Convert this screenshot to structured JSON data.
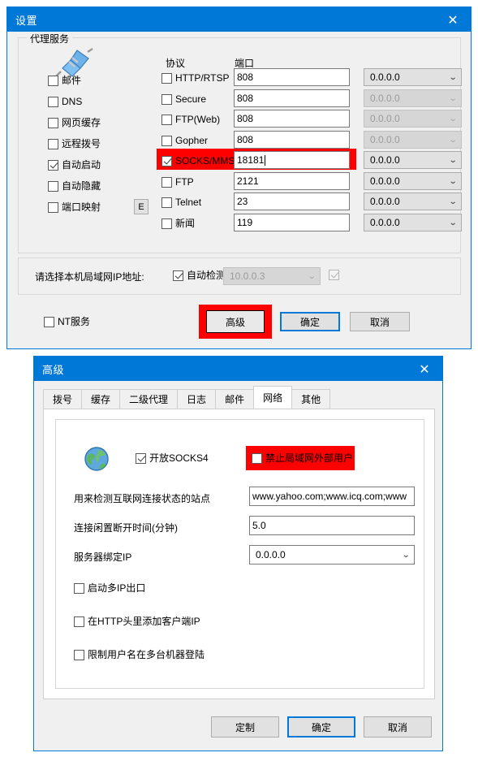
{
  "settings_window": {
    "title": "设置",
    "close_icon": "close-icon",
    "proxy_group": {
      "legend": "代理服务",
      "icon": "plug-connector-icon",
      "col_protocol": "协议",
      "col_port": "端口",
      "left_options": [
        {
          "label": "邮件",
          "checked": false
        },
        {
          "label": "DNS",
          "checked": false
        },
        {
          "label": "网页缓存",
          "checked": false
        },
        {
          "label": "远程拨号",
          "checked": false
        },
        {
          "label": "自动启动",
          "checked": true
        },
        {
          "label": "自动隐藏",
          "checked": false
        },
        {
          "label": "端口映射",
          "checked": false
        }
      ],
      "port_map_button": "E",
      "protocols": [
        {
          "label": "HTTP/RTSP",
          "checked": false,
          "port": "808",
          "ip": "0.0.0.0",
          "ip_disabled": false,
          "highlight": false,
          "caret": false
        },
        {
          "label": "Secure",
          "checked": false,
          "port": "808",
          "ip": "0.0.0.0",
          "ip_disabled": true,
          "highlight": false,
          "caret": false
        },
        {
          "label": "FTP(Web)",
          "checked": false,
          "port": "808",
          "ip": "0.0.0.0",
          "ip_disabled": true,
          "highlight": false,
          "caret": false
        },
        {
          "label": "Gopher",
          "checked": false,
          "port": "808",
          "ip": "0.0.0.0",
          "ip_disabled": true,
          "highlight": false,
          "caret": false
        },
        {
          "label": "SOCKS/MMS",
          "checked": true,
          "port": "18181",
          "ip": "0.0.0.0",
          "ip_disabled": false,
          "highlight": true,
          "caret": true
        },
        {
          "label": "FTP",
          "checked": false,
          "port": "2121",
          "ip": "0.0.0.0",
          "ip_disabled": false,
          "highlight": false,
          "caret": false
        },
        {
          "label": "Telnet",
          "checked": false,
          "port": "23",
          "ip": "0.0.0.0",
          "ip_disabled": false,
          "highlight": false,
          "caret": false
        },
        {
          "label": "新闻",
          "checked": false,
          "port": "119",
          "ip": "0.0.0.0",
          "ip_disabled": false,
          "highlight": false,
          "caret": false
        }
      ]
    },
    "ip_group": {
      "label": "请选择本机局域网IP地址:",
      "auto_detect": {
        "label": "自动检测",
        "checked": true
      },
      "ip_value": "10.0.0.3",
      "extra_checkbox_checked": true
    },
    "footer": {
      "nt_service": {
        "label": "NT服务",
        "checked": false
      },
      "advanced_button": "高级",
      "ok_button": "确定",
      "cancel_button": "取消"
    }
  },
  "advanced_window": {
    "title": "高级",
    "close_icon": "close-icon",
    "tabs": [
      {
        "label": "拨号",
        "active": false
      },
      {
        "label": "缓存",
        "active": false
      },
      {
        "label": "二级代理",
        "active": false
      },
      {
        "label": "日志",
        "active": false
      },
      {
        "label": "邮件",
        "active": false
      },
      {
        "label": "网络",
        "active": true
      },
      {
        "label": "其他",
        "active": false
      }
    ],
    "network_tab": {
      "icon": "globe-icon",
      "open_socks4": {
        "label": "开放SOCKS4",
        "checked": true
      },
      "block_external": {
        "label": "禁止局域网外部用户",
        "checked": false
      },
      "detect_site_label": "用来检测互联网连接状态的站点",
      "detect_site_value": "www.yahoo.com;www.icq.com;www",
      "idle_timeout_label": "连接闲置断开时间(分钟)",
      "idle_timeout_value": "5.0",
      "bind_ip_label": "服务器绑定IP",
      "bind_ip_value": "0.0.0.0",
      "options": [
        {
          "label": "启动多IP出口",
          "checked": false
        },
        {
          "label": "在HTTP头里添加客户端IP",
          "checked": false
        },
        {
          "label": "限制用户名在多台机器登陆",
          "checked": false
        }
      ]
    },
    "footer": {
      "custom_button": "定制",
      "ok_button": "确定",
      "cancel_button": "取消"
    }
  },
  "colors": {
    "title_blue": "#0078d7",
    "highlight_red": "#ff0000",
    "focus_blue": "#0078d7",
    "window_bg": "#f0f0f0"
  }
}
